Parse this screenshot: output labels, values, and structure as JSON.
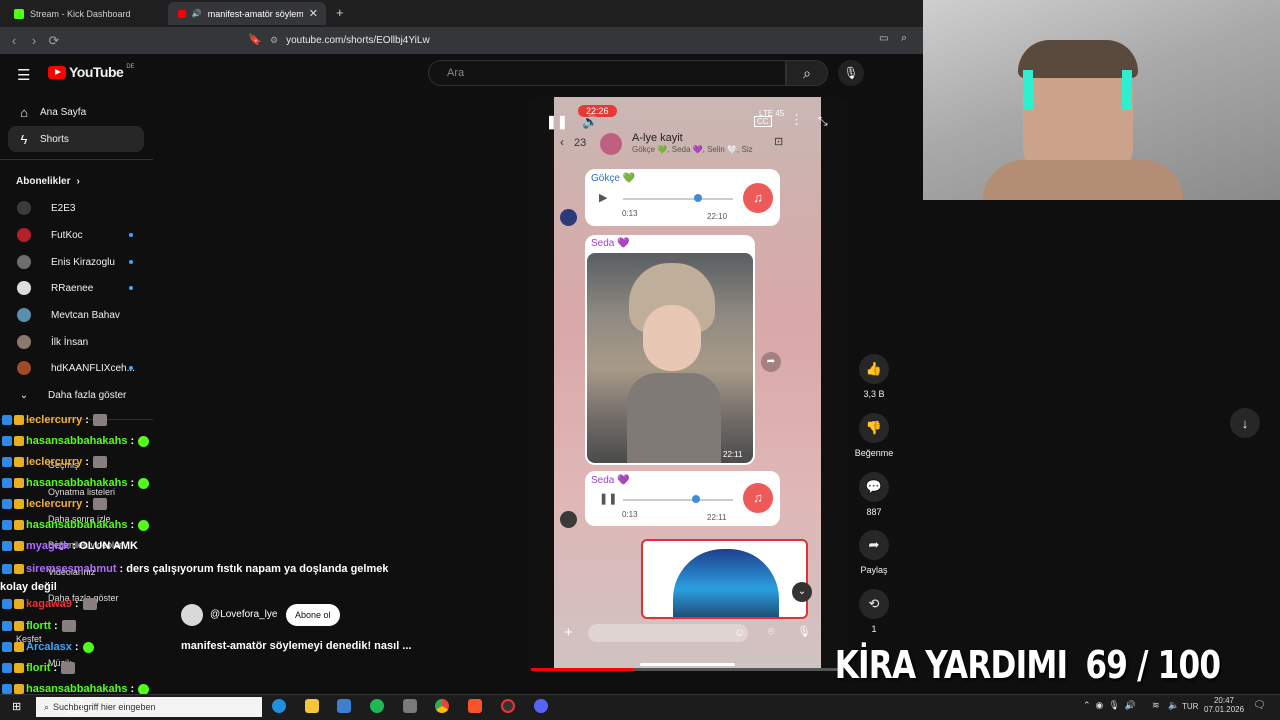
{
  "browser": {
    "tabs": [
      {
        "label": "Stream - Kick Dashboard",
        "active": false
      },
      {
        "label": "manifest-amatör söylemeyi d...",
        "active": true
      }
    ],
    "new_tab": "+",
    "url": "youtube.com/shorts/EOllbj4YiLw"
  },
  "youtube": {
    "logo_text": "YouTube",
    "logo_region": "DE",
    "search_placeholder": "Ara",
    "nav": [
      {
        "label": "Ana Sayfa",
        "icon": "home-icon"
      },
      {
        "label": "Shorts",
        "icon": "shorts-icon",
        "active": true
      }
    ],
    "subs_header": "Abonelikler",
    "subscriptions": [
      {
        "name": "E2E3",
        "dot": false,
        "color": "#3b3b3b"
      },
      {
        "name": "FutKoc",
        "dot": true,
        "color": "#b3202a"
      },
      {
        "name": "Enis Kirazoglu",
        "dot": true,
        "color": "#6e6e6e"
      },
      {
        "name": "RRaenee",
        "dot": true,
        "color": "#dedede"
      },
      {
        "name": "Mevtcan Bahav",
        "dot": false,
        "color": "#5a8fb0"
      },
      {
        "name": "İlk İnsan",
        "dot": false,
        "color": "#8a7a6a"
      },
      {
        "name": "hdKAANFLIXceh...",
        "dot": true,
        "color": "#a04a2a"
      }
    ],
    "show_more": "Daha fazla göster",
    "under_chat": [
      "Geçmiş",
      "Oynatma listeleri",
      "Daha sonra izle",
      "Beğenilen videolar",
      "Videolarınız",
      "Daha fazla göster",
      "Keşfet",
      "Müzik"
    ],
    "short": {
      "channel": "@Lovefora_lye",
      "subscribe": "Abone ol",
      "title": "manifest-amatör söylemeyi denedik! nasıl ...",
      "phone_time": "22:26",
      "phone_status": "LTE 45",
      "group_count": "23",
      "group_name": "A-lye kayit",
      "group_members": "Gökçe 💚, Seda 💜, Selin 🤍, Siz",
      "msg1_sender": "Gökçe 💚",
      "msg1_duration": "0:13",
      "msg1_time": "22:10",
      "msg2_sender": "Seda 💜",
      "msg2_time": "22:11",
      "msg3_sender": "Seda 💜",
      "msg3_duration": "0:13",
      "msg3_time": "22:11"
    },
    "actions": [
      {
        "icon": "like-icon",
        "label": "3,3 B"
      },
      {
        "icon": "dislike-icon",
        "label": "Beğenme"
      },
      {
        "icon": "comment-icon",
        "label": "887"
      },
      {
        "icon": "share-icon",
        "label": "Paylaş"
      },
      {
        "icon": "remix-icon",
        "label": "1"
      }
    ]
  },
  "chat": [
    {
      "user": "leclercurry",
      "color": "#f0b03a",
      "text": ":",
      "emote": true
    },
    {
      "user": "hasansabbahakahs",
      "color": "#53fc18",
      "text": ":",
      "gem": true
    },
    {
      "user": "leclercurry",
      "color": "#f0b03a",
      "text": ":",
      "emote": true
    },
    {
      "user": "hasansabbahakahs",
      "color": "#53fc18",
      "text": ":",
      "gem": true
    },
    {
      "user": "leclercurry",
      "color": "#f0b03a",
      "text": ":",
      "emote": true
    },
    {
      "user": "hasansabbahakahs",
      "color": "#53fc18",
      "text": ":",
      "gem": true
    },
    {
      "user": "myagizk",
      "color": "#b06cff",
      "text": ": OLUN AMK",
      "emote": false
    },
    {
      "user": "siremsesmahmut",
      "color": "#b06cff",
      "text": ": ders çalışıyorum fıstık napam ya doşlanda gelmek kolay değil",
      "emote": false
    },
    {
      "user": "kagawa9",
      "color": "#e33",
      "text": ":",
      "emote": true
    },
    {
      "user": "flortt",
      "color": "#53fc18",
      "text": ":",
      "emote": true
    },
    {
      "user": "Arcalasx",
      "color": "#3ea6ff",
      "text": ":",
      "gem": true
    },
    {
      "user": "florit",
      "color": "#53fc18",
      "text": ":",
      "emote": true
    },
    {
      "user": "hasansabbahakahs",
      "color": "#53fc18",
      "text": ":",
      "gem": true
    }
  ],
  "overlay": {
    "kira_label": "KİRA YARDIMI",
    "kira_progress": "69 / 100"
  },
  "taskbar": {
    "search_placeholder": "Suchbegriff hier eingeben",
    "lang": "TUR",
    "time": "20:47",
    "date": "07.01.2026"
  }
}
